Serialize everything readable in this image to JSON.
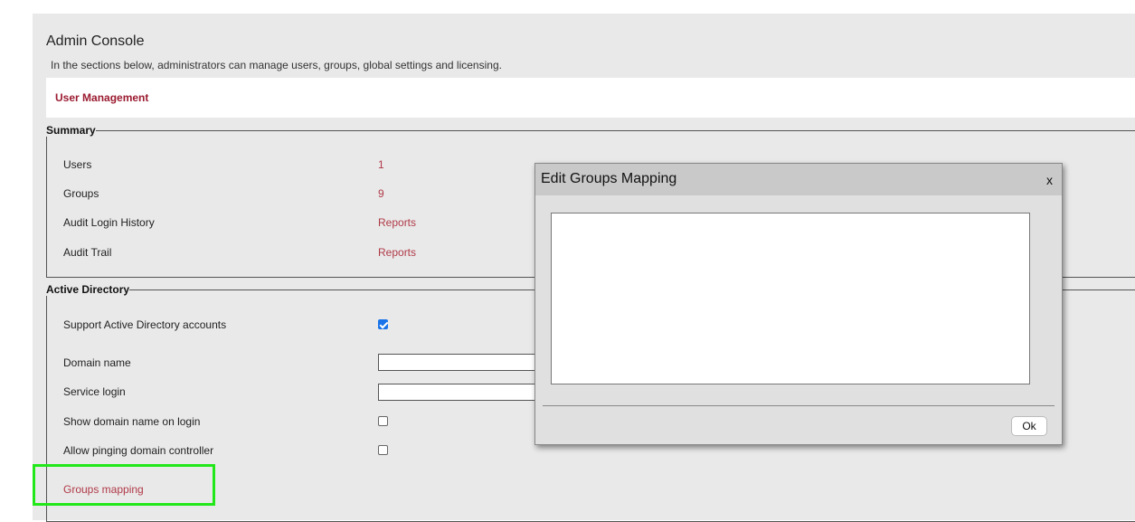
{
  "admin": {
    "title": "Admin Console",
    "subtitle": "In the sections below, administrators can manage users, groups, global settings and licensing."
  },
  "section": {
    "title": "User Management"
  },
  "summary": {
    "legend": "Summary",
    "rows": [
      {
        "label": "Users",
        "value": "1"
      },
      {
        "label": "Groups",
        "value": "9"
      },
      {
        "label": "Audit Login History",
        "value": "Reports"
      },
      {
        "label": "Audit Trail",
        "value": "Reports"
      }
    ]
  },
  "active_directory": {
    "legend": "Active Directory",
    "support_label": "Support Active Directory accounts",
    "support_checked": true,
    "domain_name_label": "Domain name",
    "domain_name_value": "",
    "service_login_label": "Service login",
    "service_login_value": "",
    "show_domain_label": "Show domain name on login",
    "show_domain_checked": false,
    "allow_ping_label": "Allow pinging domain controller",
    "allow_ping_checked": false,
    "groups_mapping_link": "Groups mapping"
  },
  "dialog": {
    "title": "Edit Groups Mapping",
    "close_label": "x",
    "textarea_value": "",
    "ok_label": "Ok"
  },
  "colors": {
    "link": "#b03a48",
    "section_title": "#9b1b30",
    "highlight": "#22e81a",
    "checkbox_checked": "#1a73e8"
  }
}
